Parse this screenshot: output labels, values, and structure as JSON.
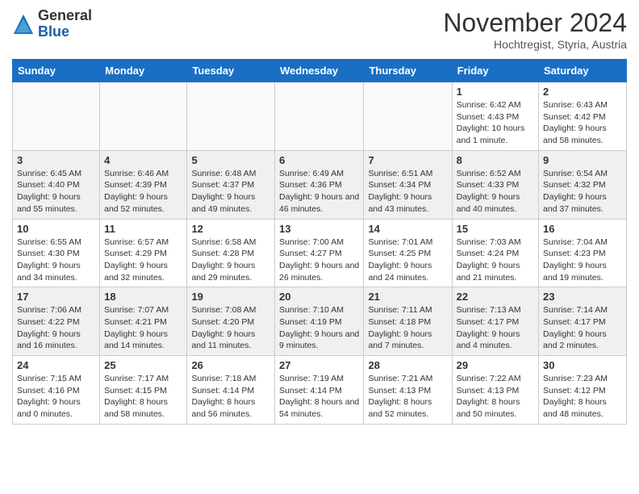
{
  "header": {
    "logo_general": "General",
    "logo_blue": "Blue",
    "month": "November 2024",
    "location": "Hochtregist, Styria, Austria"
  },
  "days_of_week": [
    "Sunday",
    "Monday",
    "Tuesday",
    "Wednesday",
    "Thursday",
    "Friday",
    "Saturday"
  ],
  "weeks": [
    [
      {
        "day": "",
        "info": ""
      },
      {
        "day": "",
        "info": ""
      },
      {
        "day": "",
        "info": ""
      },
      {
        "day": "",
        "info": ""
      },
      {
        "day": "",
        "info": ""
      },
      {
        "day": "1",
        "info": "Sunrise: 6:42 AM\nSunset: 4:43 PM\nDaylight: 10 hours and 1 minute."
      },
      {
        "day": "2",
        "info": "Sunrise: 6:43 AM\nSunset: 4:42 PM\nDaylight: 9 hours and 58 minutes."
      }
    ],
    [
      {
        "day": "3",
        "info": "Sunrise: 6:45 AM\nSunset: 4:40 PM\nDaylight: 9 hours and 55 minutes."
      },
      {
        "day": "4",
        "info": "Sunrise: 6:46 AM\nSunset: 4:39 PM\nDaylight: 9 hours and 52 minutes."
      },
      {
        "day": "5",
        "info": "Sunrise: 6:48 AM\nSunset: 4:37 PM\nDaylight: 9 hours and 49 minutes."
      },
      {
        "day": "6",
        "info": "Sunrise: 6:49 AM\nSunset: 4:36 PM\nDaylight: 9 hours and 46 minutes."
      },
      {
        "day": "7",
        "info": "Sunrise: 6:51 AM\nSunset: 4:34 PM\nDaylight: 9 hours and 43 minutes."
      },
      {
        "day": "8",
        "info": "Sunrise: 6:52 AM\nSunset: 4:33 PM\nDaylight: 9 hours and 40 minutes."
      },
      {
        "day": "9",
        "info": "Sunrise: 6:54 AM\nSunset: 4:32 PM\nDaylight: 9 hours and 37 minutes."
      }
    ],
    [
      {
        "day": "10",
        "info": "Sunrise: 6:55 AM\nSunset: 4:30 PM\nDaylight: 9 hours and 34 minutes."
      },
      {
        "day": "11",
        "info": "Sunrise: 6:57 AM\nSunset: 4:29 PM\nDaylight: 9 hours and 32 minutes."
      },
      {
        "day": "12",
        "info": "Sunrise: 6:58 AM\nSunset: 4:28 PM\nDaylight: 9 hours and 29 minutes."
      },
      {
        "day": "13",
        "info": "Sunrise: 7:00 AM\nSunset: 4:27 PM\nDaylight: 9 hours and 26 minutes."
      },
      {
        "day": "14",
        "info": "Sunrise: 7:01 AM\nSunset: 4:25 PM\nDaylight: 9 hours and 24 minutes."
      },
      {
        "day": "15",
        "info": "Sunrise: 7:03 AM\nSunset: 4:24 PM\nDaylight: 9 hours and 21 minutes."
      },
      {
        "day": "16",
        "info": "Sunrise: 7:04 AM\nSunset: 4:23 PM\nDaylight: 9 hours and 19 minutes."
      }
    ],
    [
      {
        "day": "17",
        "info": "Sunrise: 7:06 AM\nSunset: 4:22 PM\nDaylight: 9 hours and 16 minutes."
      },
      {
        "day": "18",
        "info": "Sunrise: 7:07 AM\nSunset: 4:21 PM\nDaylight: 9 hours and 14 minutes."
      },
      {
        "day": "19",
        "info": "Sunrise: 7:08 AM\nSunset: 4:20 PM\nDaylight: 9 hours and 11 minutes."
      },
      {
        "day": "20",
        "info": "Sunrise: 7:10 AM\nSunset: 4:19 PM\nDaylight: 9 hours and 9 minutes."
      },
      {
        "day": "21",
        "info": "Sunrise: 7:11 AM\nSunset: 4:18 PM\nDaylight: 9 hours and 7 minutes."
      },
      {
        "day": "22",
        "info": "Sunrise: 7:13 AM\nSunset: 4:17 PM\nDaylight: 9 hours and 4 minutes."
      },
      {
        "day": "23",
        "info": "Sunrise: 7:14 AM\nSunset: 4:17 PM\nDaylight: 9 hours and 2 minutes."
      }
    ],
    [
      {
        "day": "24",
        "info": "Sunrise: 7:15 AM\nSunset: 4:16 PM\nDaylight: 9 hours and 0 minutes."
      },
      {
        "day": "25",
        "info": "Sunrise: 7:17 AM\nSunset: 4:15 PM\nDaylight: 8 hours and 58 minutes."
      },
      {
        "day": "26",
        "info": "Sunrise: 7:18 AM\nSunset: 4:14 PM\nDaylight: 8 hours and 56 minutes."
      },
      {
        "day": "27",
        "info": "Sunrise: 7:19 AM\nSunset: 4:14 PM\nDaylight: 8 hours and 54 minutes."
      },
      {
        "day": "28",
        "info": "Sunrise: 7:21 AM\nSunset: 4:13 PM\nDaylight: 8 hours and 52 minutes."
      },
      {
        "day": "29",
        "info": "Sunrise: 7:22 AM\nSunset: 4:13 PM\nDaylight: 8 hours and 50 minutes."
      },
      {
        "day": "30",
        "info": "Sunrise: 7:23 AM\nSunset: 4:12 PM\nDaylight: 8 hours and 48 minutes."
      }
    ]
  ]
}
